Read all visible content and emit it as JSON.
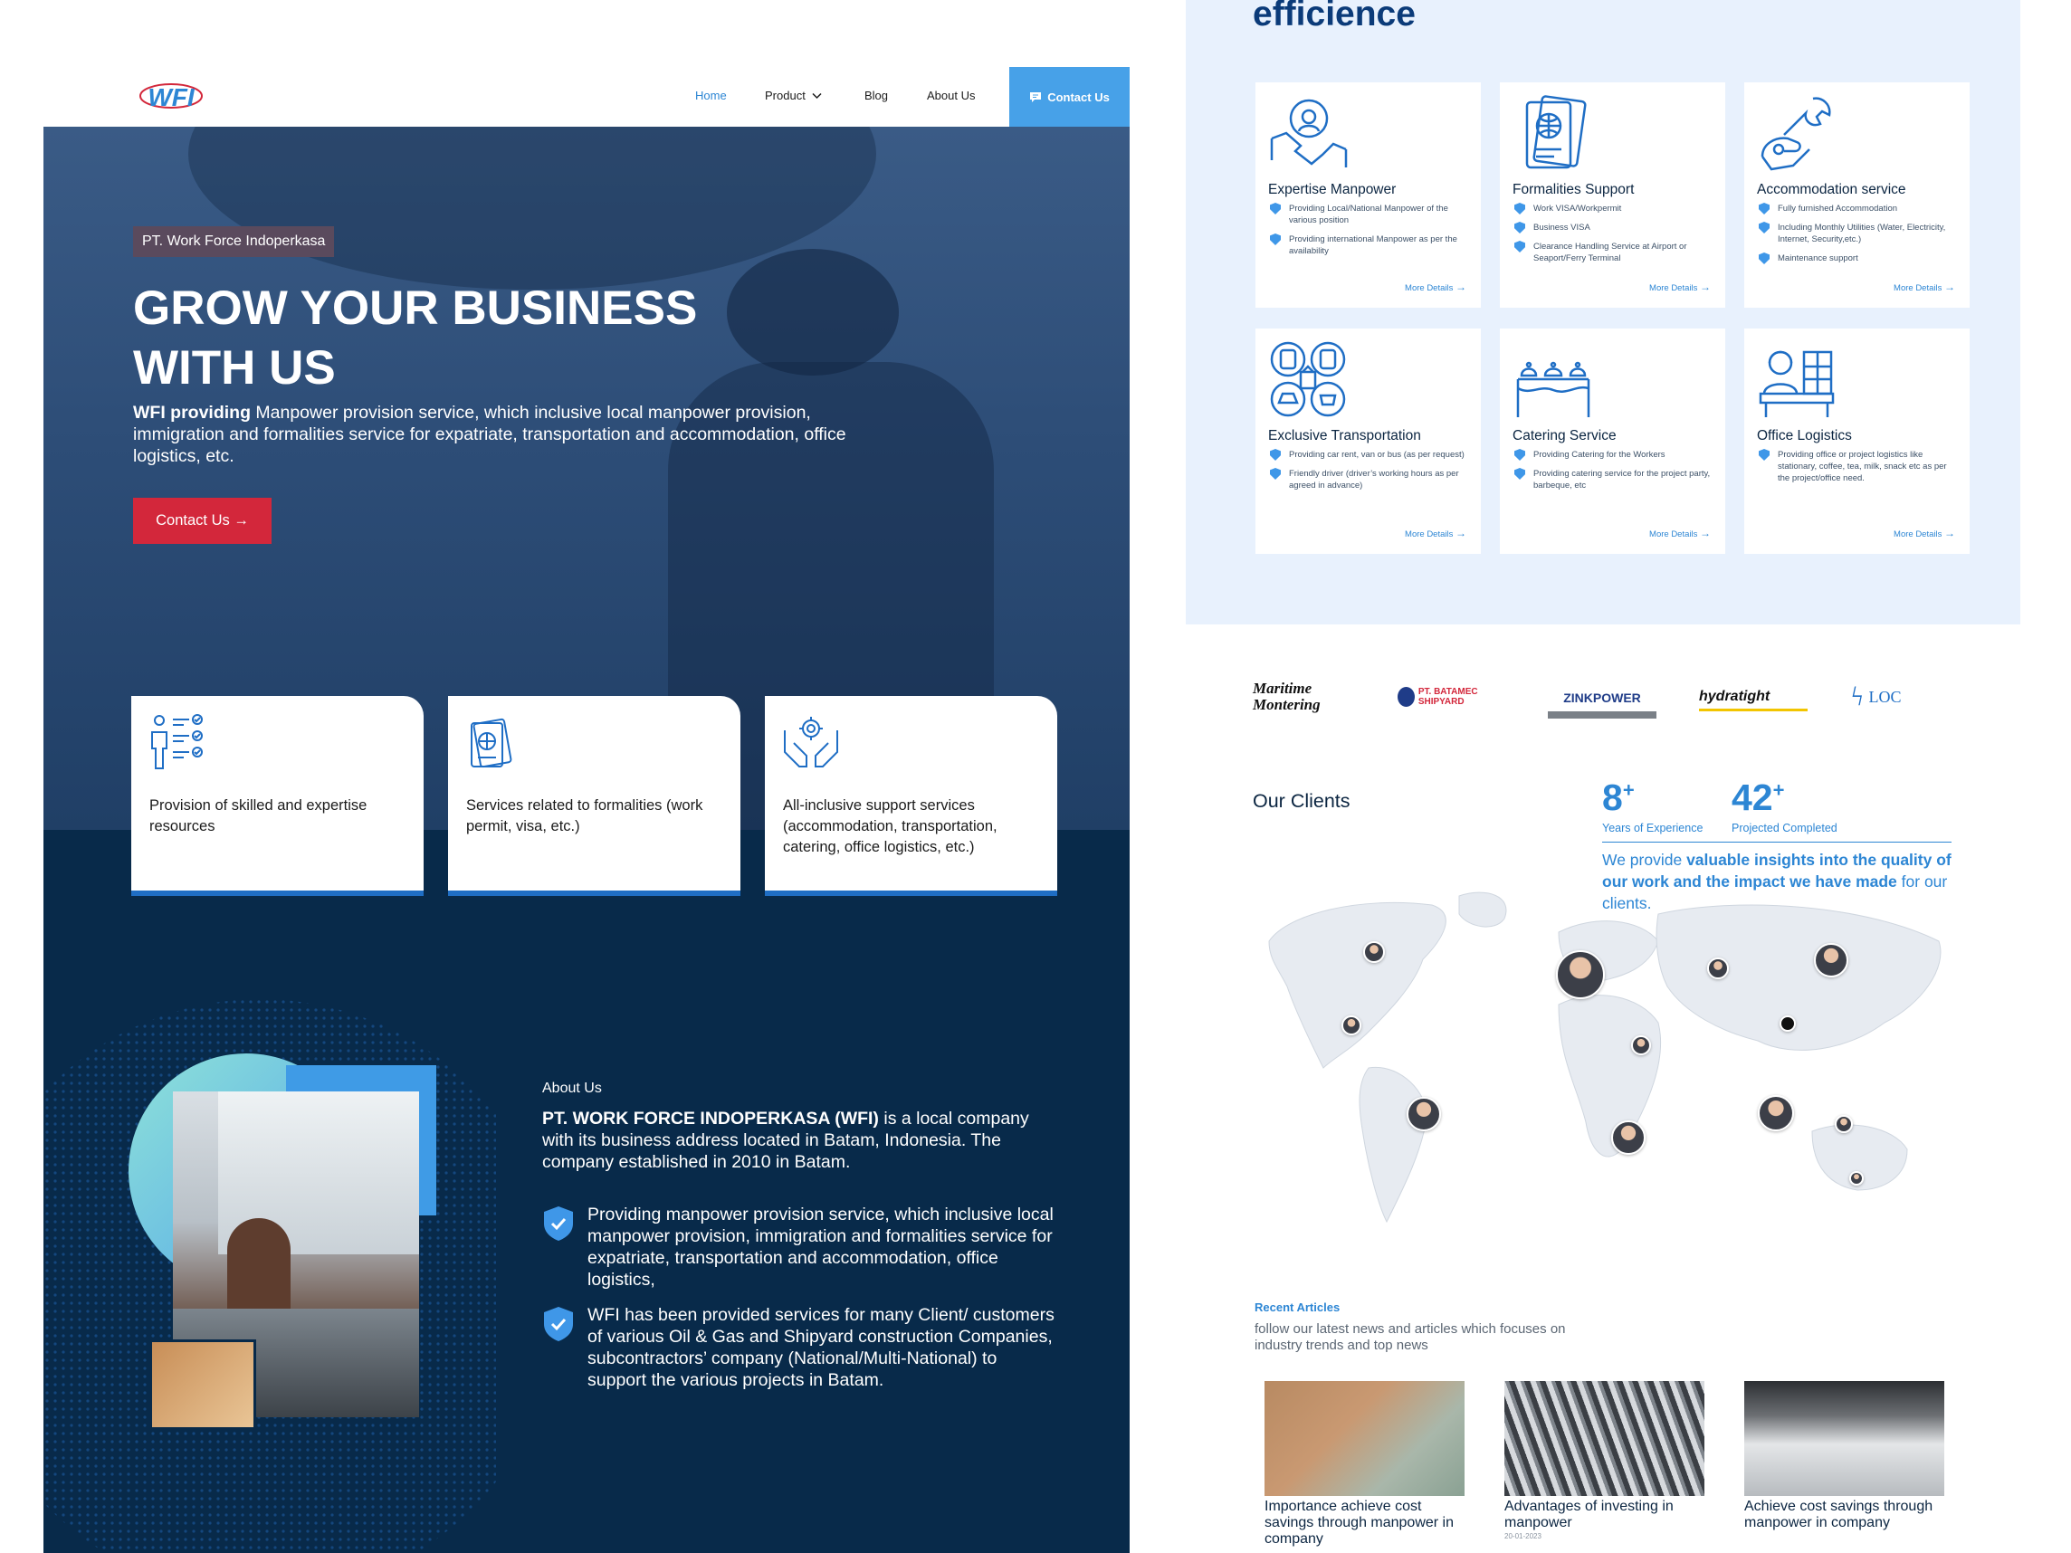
{
  "nav": {
    "logo_text": "WFI",
    "home": "Home",
    "product": "Product",
    "blog": "Blog",
    "about": "About Us",
    "contact": "Contact Us"
  },
  "hero": {
    "badge": "PT. Work Force Indoperkasa",
    "title": "GROW YOUR BUSINESS WITH US",
    "desc_bold": "WFI providing",
    "desc": " Manpower provision service, which inclusive local manpower provision, immigration and formalities service for expatriate, transportation and accommodation, office logistics, etc.",
    "cta": "Contact Us →"
  },
  "features": [
    {
      "text": "Provision of skilled and expertise resources",
      "icon": "people-checklist-icon"
    },
    {
      "text": "Services related to formalities (work permit, visa, etc.)",
      "icon": "passport-icon"
    },
    {
      "text": "All-inclusive support services (accommodation, transportation, catering, office logistics, etc.)",
      "icon": "hands-gear-icon"
    }
  ],
  "about": {
    "label": "About Us",
    "company_bold": "PT. WORK FORCE INDOPERKASA (WFI)",
    "company_text": " is a local company with its business address located in Batam, Indonesia. The company established in 2010 in Batam.",
    "items": [
      "Providing manpower provision service, which inclusive local manpower provision, immigration and formalities service for expatriate, transportation and accommodation, office logistics,",
      "WFI has been provided services for many Client/ customers of various Oil & Gas and Shipyard construction Companies, subcontractors’ company (National/Multi-National) to support the various projects in Batam."
    ]
  },
  "services": {
    "title": "efficience",
    "more": "More Details",
    "items": [
      {
        "title": "Expertise Manpower",
        "icon": "handshake-gear-icon",
        "points": [
          "Providing Local/National Manpower of the various position",
          "Providing international Manpower as per the availability"
        ]
      },
      {
        "title": "Formalities Support",
        "icon": "passport-icon",
        "points": [
          "Work VISA/Workpermit",
          "Business VISA",
          "Clearance Handling Service at Airport or Seaport/Ferry Terminal"
        ]
      },
      {
        "title": "Accommodation service",
        "icon": "wrench-hand-icon",
        "points": [
          "Fully furnished Accommodation",
          "Including Monthly Utilities (Water, Electricity, Internet, Security,etc.)",
          "Maintenance support"
        ]
      },
      {
        "title": "Exclusive Transportation",
        "icon": "transport-icon",
        "points": [
          "Providing car rent, van or bus (as per request)",
          "Friendly driver (driver’s working hours as per agreed in advance)"
        ]
      },
      {
        "title": "Catering Service",
        "icon": "catering-icon",
        "points": [
          "Providing Catering for the Workers",
          "Providing catering service for the project party, barbeque, etc"
        ]
      },
      {
        "title": "Office Logistics",
        "icon": "office-desk-icon",
        "points": [
          "Providing office or project logistics like stationary, coffee, tea, milk, snack etc as per the project/office need."
        ]
      }
    ]
  },
  "clients": {
    "logos": [
      "Maritime Montering",
      "PT. BATAMEC SHIPYARD",
      "ZINKPOWER",
      "hydratight",
      "LOC"
    ],
    "title": "Our Clients",
    "years_num": "8",
    "years_label": "Years of Experience",
    "projects_num": "42",
    "projects_label": "Projected Completed",
    "plus": "+",
    "insight_pre": "We provide ",
    "insight_bold": "valuable insights into the quality of our work and the impact we have made",
    "insight_post": " for our clients."
  },
  "articles": {
    "title": "Recent Articles",
    "desc": "follow our latest news and articles which focuses on industry trends and top news",
    "items": [
      {
        "title": "Importance achieve cost savings through manpower in company",
        "date": ""
      },
      {
        "title": "Advantages of investing in manpower",
        "date": "20-01-2023"
      },
      {
        "title": "Achieve cost savings through manpower in company",
        "date": ""
      }
    ]
  },
  "colors": {
    "navy": "#082a4a",
    "accent": "#2d86d4",
    "cta_red": "#d3273b",
    "light_bg": "#e8f1fd"
  }
}
